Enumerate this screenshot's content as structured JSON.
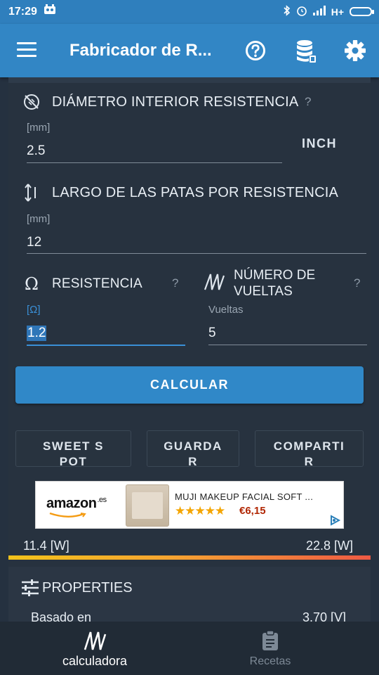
{
  "status_bar": {
    "time": "17:29",
    "network": "H+"
  },
  "app_bar": {
    "title": "Fabricador de R..."
  },
  "fields": {
    "diameter": {
      "label": "DIÁMETRO INTERIOR RESISTENCIA",
      "help": "?",
      "unit": "[mm]",
      "value": "2.5",
      "unit_toggle": "INCH"
    },
    "leg_length": {
      "label": "LARGO DE LAS PATAS POR RESISTENCIA",
      "unit": "[mm]",
      "value": "12"
    },
    "resistance": {
      "label": "RESISTENCIA",
      "help": "?",
      "unit": "[Ω]",
      "value": "1.2"
    },
    "turns": {
      "label": "NÚMERO DE VUELTAS",
      "help": "?",
      "unit": "Vueltas",
      "value": "5"
    }
  },
  "actions": {
    "calculate": "CALCULAR",
    "sweet_spot": "SWEET SPOT",
    "save": "GUARDAR",
    "share": "COMPARTIR"
  },
  "ad": {
    "brand": "amazon",
    "brand_suffix": ".es",
    "product_title": "MUJI MAKEUP FACIAL SOFT ...",
    "stars": "★★★★★",
    "rating": 5,
    "price": "€6,15"
  },
  "power": {
    "min": "11.4 [W]",
    "max": "22.8 [W]"
  },
  "properties": {
    "title": "PROPERTIES",
    "rows": [
      {
        "label": "Basado en",
        "value": "3.70 [V]"
      }
    ]
  },
  "bottom_nav": [
    {
      "label": "calculadora",
      "active": true
    },
    {
      "label": "Recetas",
      "active": false
    }
  ],
  "colors": {
    "app_bar": "#3286c5",
    "status_bar": "#2f7fbd",
    "background": "#253140",
    "accent": "#3088c8"
  }
}
